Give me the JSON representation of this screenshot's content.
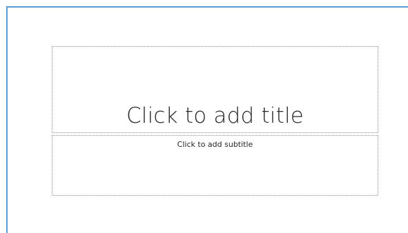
{
  "slide": {
    "title_placeholder": "Click to add title",
    "subtitle_placeholder": "Click to add subtitle"
  },
  "colors": {
    "slide_edge": "#5b9bd5",
    "placeholder_border": "#8c8c8c",
    "text": "#262626"
  }
}
